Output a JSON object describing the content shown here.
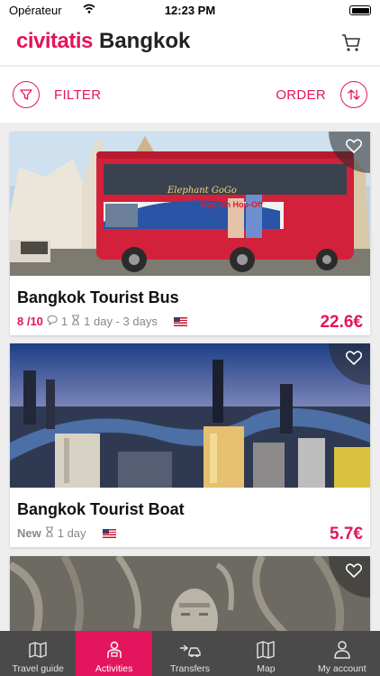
{
  "status": {
    "carrier": "Opérateur",
    "time": "12:23 PM"
  },
  "header": {
    "logo": "civitatis",
    "city": "Bangkok"
  },
  "toolbar": {
    "filter_label": "FILTER",
    "order_label": "ORDER"
  },
  "cards": [
    {
      "title": "Bangkok Tourist Bus",
      "rating": "8 /10",
      "reviews": "1",
      "duration": "1 day - 3 days",
      "price": "22.6€"
    },
    {
      "title": "Bangkok Tourist Boat",
      "badge": "New",
      "duration": "1 day",
      "price": "5.7€"
    },
    {
      "title": ""
    }
  ],
  "bus_overlay": {
    "brand": "Elephant GoGo",
    "tagline": "Hop-On Hop-Off"
  },
  "tabs": [
    {
      "label": "Travel guide",
      "icon": "map-book-icon"
    },
    {
      "label": "Activities",
      "icon": "person-icon"
    },
    {
      "label": "Transfers",
      "icon": "transfer-car-icon"
    },
    {
      "label": "Map",
      "icon": "map-icon"
    },
    {
      "label": "My account",
      "icon": "user-icon"
    }
  ],
  "colors": {
    "accent": "#e3155d",
    "tabbar": "#4a4a4a",
    "page_bg": "#eeeeee"
  }
}
